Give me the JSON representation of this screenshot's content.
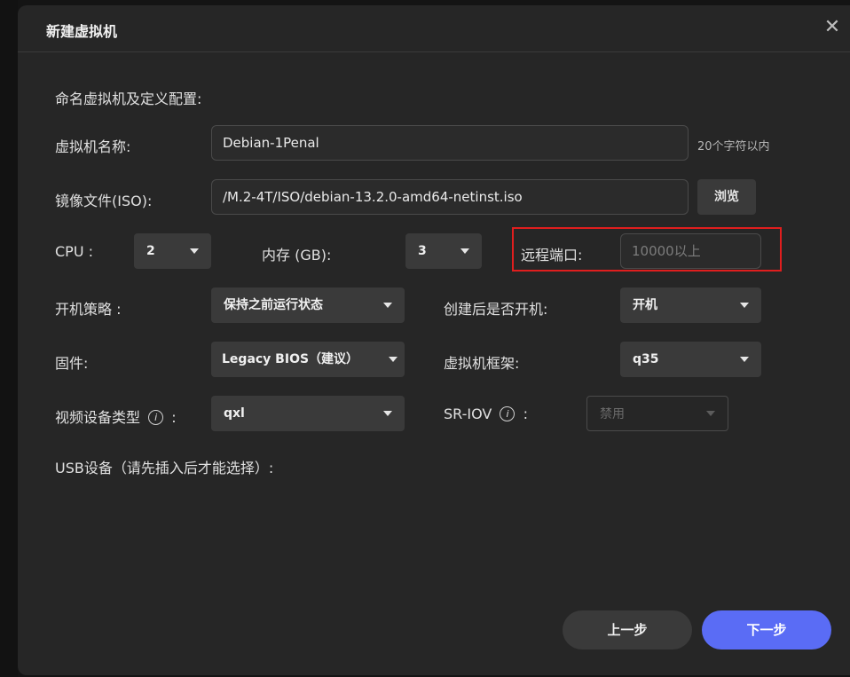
{
  "dialog": {
    "title": "新建虚拟机",
    "close_icon": "close-icon"
  },
  "form": {
    "section_label": "命名虚拟机及定义配置:",
    "vm_name": {
      "label": "虚拟机名称:",
      "value": "Debian-1Penal",
      "hint": "20个字符以内"
    },
    "iso": {
      "label": "镜像文件(ISO):",
      "value": "/M.2-4T/ISO/debian-13.2.0-amd64-netinst.iso",
      "browse_label": "浏览"
    },
    "cpu": {
      "label": "CPU :",
      "value": "2"
    },
    "memory": {
      "label": "内存 (GB):",
      "value": "3"
    },
    "remote_port": {
      "label": "远程端口:",
      "placeholder": "10000以上"
    },
    "boot_policy": {
      "label": "开机策略 :",
      "value": "保持之前运行状态"
    },
    "power_on_after_create": {
      "label": "创建后是否开机:",
      "value": "开机"
    },
    "firmware": {
      "label": "固件:",
      "value": "Legacy BIOS（建议）"
    },
    "vm_arch": {
      "label": "虚拟机框架:",
      "value": "q35"
    },
    "video_device": {
      "label": "视频设备类型",
      "suffix": ":",
      "value": "qxl"
    },
    "sriov": {
      "label": "SR-IOV",
      "suffix": ":",
      "value": "禁用"
    },
    "usb": {
      "label": "USB设备（请先插入后才能选择）:"
    }
  },
  "footer": {
    "prev_label": "上一步",
    "next_label": "下一步"
  },
  "colors": {
    "accent": "#5a6cf5",
    "highlight": "#e01e1e",
    "dialog_bg": "#262626"
  }
}
